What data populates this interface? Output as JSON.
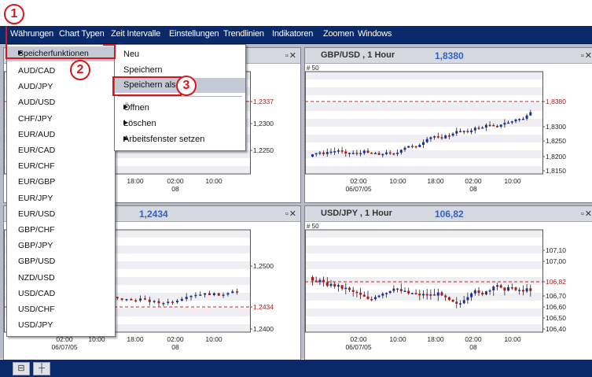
{
  "menubar": {
    "items": [
      "Währungen",
      "Chart Typen",
      "Zeit Intervalle",
      "Einstellungen",
      "Trendlinien",
      "Indikatoren",
      "Zoomen",
      "Windows"
    ]
  },
  "pair_menu": {
    "header": "Speicherfunktionen",
    "items": [
      "AUD/CAD",
      "AUD/JPY",
      "AUD/USD",
      "CHF/JPY",
      "EUR/AUD",
      "EUR/CAD",
      "EUR/CHF",
      "EUR/GBP",
      "EUR/JPY",
      "EUR/USD",
      "GBP/CHF",
      "GBP/JPY",
      "GBP/USD",
      "NZD/USD",
      "USD/CAD",
      "USD/CHF",
      "USD/JPY"
    ]
  },
  "sub_menu": {
    "items": [
      {
        "label": "Neu",
        "arrow": false
      },
      {
        "label": "Speichern",
        "arrow": false
      },
      {
        "label": "Speichern als",
        "arrow": false,
        "highlight": true
      },
      {
        "label": "Öffnen",
        "arrow": true
      },
      {
        "label": "Löschen",
        "arrow": true
      },
      {
        "label": "Arbeitsfenster setzen",
        "arrow": true
      }
    ]
  },
  "markers": [
    "1",
    "2",
    "3"
  ],
  "charts": {
    "top_left": {
      "price_labels": [
        "1,2337",
        "1,2300",
        "1,2250"
      ],
      "x_ticks": [
        "18:00",
        "02:00",
        "10:00"
      ],
      "x_sub": "08"
    },
    "top_right": {
      "symbol": "GBP/USD , 1 Hour",
      "price": "1,8380",
      "count": "# 50",
      "price_labels": [
        "1,8380",
        "1,8300",
        "1,8250",
        "1,8200",
        "1,8150"
      ],
      "x_ticks": [
        "02:00",
        "10:00",
        "18:00",
        "02:00",
        "10:00"
      ],
      "x_date": "06/07/05",
      "x_sub": "08"
    },
    "bottom_left": {
      "price": "1,2434",
      "price_labels": [
        "1,2500",
        "1,2434",
        "1,2400"
      ],
      "x_ticks": [
        "02:00",
        "10:00",
        "18:00",
        "02:00",
        "10:00"
      ],
      "x_date": "06/07/05",
      "x_sub": "08"
    },
    "bottom_right": {
      "symbol": "USD/JPY , 1 Hour",
      "price": "106,82",
      "count": "# 50",
      "price_labels": [
        "107,10",
        "107,00",
        "106,82",
        "106,70",
        "106,60",
        "106,50",
        "106,40"
      ],
      "x_ticks": [
        "02:00",
        "10:00",
        "18:00",
        "02:00",
        "10:00"
      ],
      "x_date": "06/07/05",
      "x_sub": "08"
    }
  },
  "statusbar": {
    "buttons": [
      "⊟",
      "┼"
    ]
  },
  "colors": {
    "menubar": "#0a2a6b",
    "highlight": "#c5c9d6",
    "price": "#2f62c8",
    "up": "#1a2f9e",
    "down": "#b01818",
    "marker": "#d11a1a"
  }
}
